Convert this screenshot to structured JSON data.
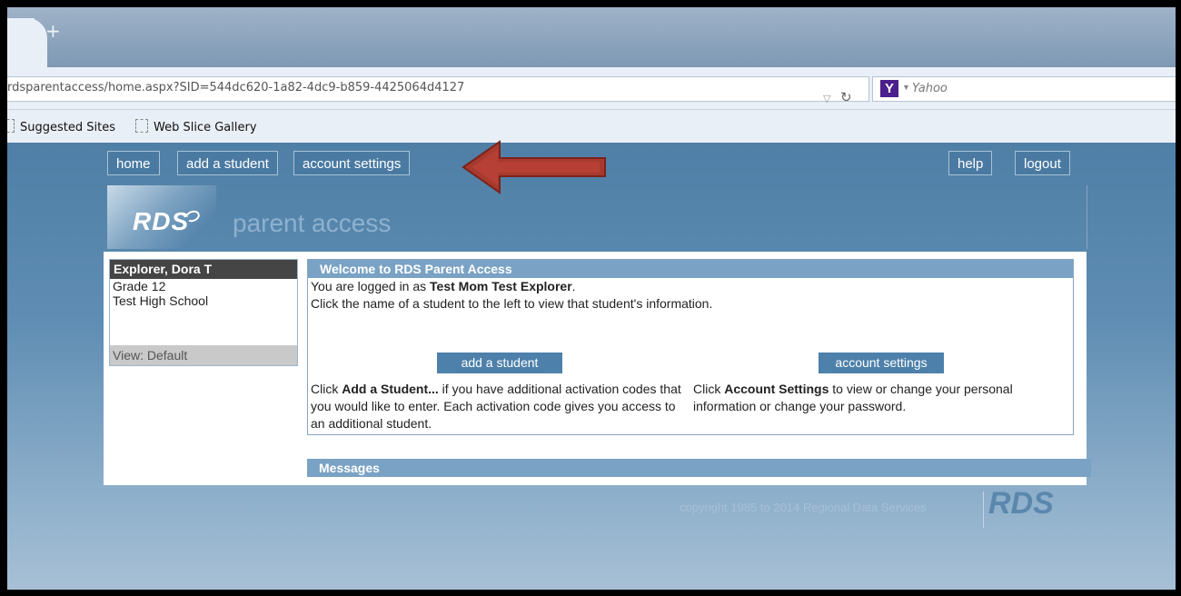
{
  "browser": {
    "new_tab_icon": "+",
    "url": "rdsparentaccess/home.aspx?SID=544dc620-1a82-4dc9-b859-4425064d4127",
    "search_engine": "Yahoo",
    "search_logo": "Y",
    "bookmarks": [
      "Suggested Sites",
      "Web Slice Gallery"
    ]
  },
  "nav": {
    "left": [
      "home",
      "add a student",
      "account settings"
    ],
    "right": [
      "help",
      "logout"
    ]
  },
  "logo": {
    "brand": "RDS",
    "tagline": "parent access"
  },
  "student": {
    "name": "Explorer, Dora T",
    "grade": "Grade 12",
    "school": "Test High School",
    "view": "View: Default"
  },
  "welcome": {
    "title": "Welcome to RDS Parent Access",
    "logged_in_prefix": "You are logged in as ",
    "logged_in_user": "Test Mom Test Explorer",
    "logged_in_suffix": ".",
    "instruction": "Click the name of a student to the left to view that student's information.",
    "add_button": "add a student",
    "settings_button": "account settings",
    "add_desc_prefix": "Click ",
    "add_desc_bold": "Add a Student...",
    "add_desc_rest": " if you have additional activation codes that you would like to enter. Each activation code gives you access to an additional student.",
    "settings_desc_prefix": "Click ",
    "settings_desc_bold": "Account Settings",
    "settings_desc_rest": " to view or change your personal information or change your password."
  },
  "messages": {
    "title": "Messages"
  },
  "footer": {
    "copyright": "copyright 1985 to 2014 Regional Data Services",
    "logo": "RDS"
  },
  "colors": {
    "annotation_arrow": "#a8392e",
    "header_blue": "#7aa2c4",
    "button_blue": "#4d80aa"
  }
}
